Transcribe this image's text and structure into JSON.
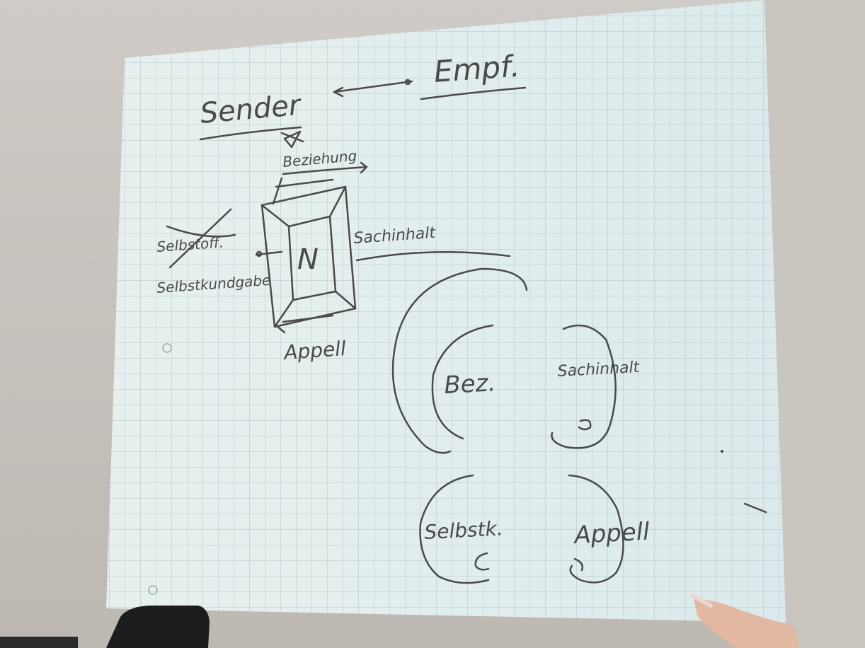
{
  "scene": {
    "projection_color": "#e3eeee",
    "grid_color": "#aab7bd",
    "ink_color": "#4a4a4a",
    "wall_color": "#c9c5bf"
  },
  "labels": {
    "sender": "Sender",
    "receiver": "Empf.",
    "relationship": "Beziehung",
    "self_crossed": "Selbstoff.",
    "self_disclosure": "Selbstkundgabe",
    "factual": "Sachinhalt",
    "appeal": "Appell",
    "box_letter": "N",
    "ear_relationship": "Bez.",
    "ear_factual": "Sachinhalt",
    "ear_self": "Selbstk.",
    "ear_appeal": "Appell"
  }
}
